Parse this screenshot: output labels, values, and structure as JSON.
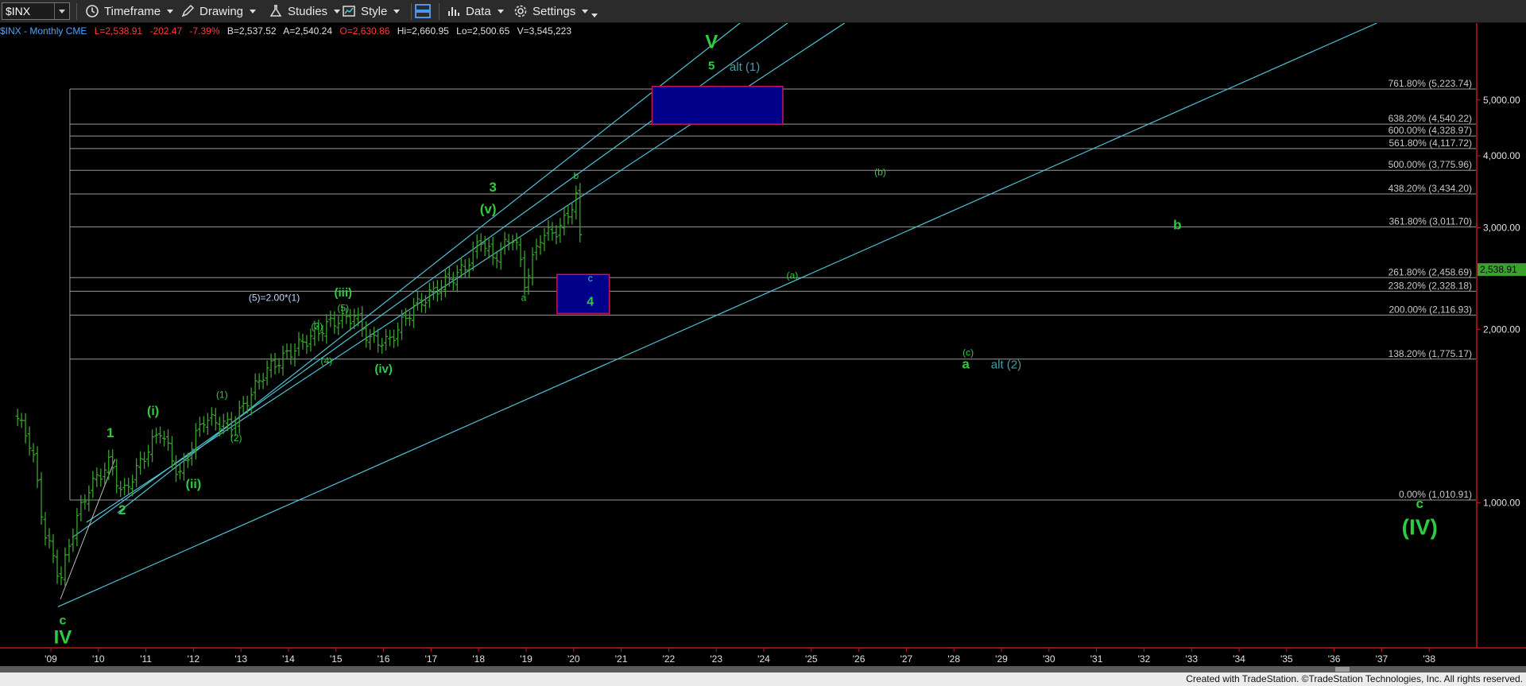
{
  "toolbar": {
    "symbol": "$INX",
    "timeframe": "Timeframe",
    "drawing": "Drawing",
    "studies": "Studies",
    "style": "Style",
    "data": "Data",
    "settings": "Settings"
  },
  "header": {
    "symbol_info": "$INX - Monthly  CME",
    "last": "L=2,538.91",
    "change": "-202.47",
    "change_pct": "-7.39%",
    "bid": "B=2,537.52",
    "ask": "A=2,540.24",
    "open": "O=2,630.86",
    "high": "Hi=2,660.95",
    "low": "Lo=2,500.65",
    "volume": "V=3,545,223"
  },
  "footer_text": "Created with TradeStation. ©TradeStation Technologies, Inc. All rights reserved.",
  "colors": {
    "price_bars": "#3aa12e",
    "channel": "#4fc3d6",
    "fib_lines": "#9a9a9a",
    "label_green": "#2ecc40",
    "label_teal": "#4a9aa8",
    "box_fill": "#00008b",
    "box_border": "#c2185b",
    "last_price_tag": "#3aa12e",
    "down": "#e53935"
  },
  "chart_data": {
    "type": "ohlc",
    "title": "$INX - Monthly",
    "ylim": [
      560,
      6800
    ],
    "log_scale": true,
    "xlim": [
      2008.25,
      2038.9
    ],
    "x_ticks": [
      "'09",
      "'10",
      "'11",
      "'12",
      "'13",
      "'14",
      "'15",
      "'16",
      "'17",
      "'18",
      "'19",
      "'20",
      "'21",
      "'22",
      "'23",
      "'24",
      "'25",
      "'26",
      "'27",
      "'28",
      "'29",
      "'30",
      "'31",
      "'32",
      "'33",
      "'34",
      "'35",
      "'36",
      "'37",
      "'38"
    ],
    "y_ticks": [
      {
        "value": 1000,
        "label": "1,000.00"
      },
      {
        "value": 2000,
        "label": "2,000.00"
      },
      {
        "value": 3000,
        "label": "3,000.00"
      },
      {
        "value": 4000,
        "label": "4,000.00"
      },
      {
        "value": 5000,
        "label": "5,000.00"
      }
    ],
    "last_price": {
      "value": 2538.91,
      "label": "2,538.91"
    },
    "price_series": [
      {
        "year": 2008.3,
        "value": 1400
      },
      {
        "year": 2008.6,
        "value": 1250
      },
      {
        "year": 2008.85,
        "value": 900
      },
      {
        "year": 2009.2,
        "value": 735
      },
      {
        "year": 2009.5,
        "value": 920
      },
      {
        "year": 2009.8,
        "value": 1060
      },
      {
        "year": 2010.25,
        "value": 1180
      },
      {
        "year": 2010.5,
        "value": 1030
      },
      {
        "year": 2010.9,
        "value": 1180
      },
      {
        "year": 2011.3,
        "value": 1340
      },
      {
        "year": 2011.7,
        "value": 1110
      },
      {
        "year": 2012.2,
        "value": 1400
      },
      {
        "year": 2012.8,
        "value": 1360
      },
      {
        "year": 2013.5,
        "value": 1690
      },
      {
        "year": 2014.2,
        "value": 1870
      },
      {
        "year": 2014.9,
        "value": 2060
      },
      {
        "year": 2015.4,
        "value": 2110
      },
      {
        "year": 2015.7,
        "value": 1920
      },
      {
        "year": 2016.1,
        "value": 1900
      },
      {
        "year": 2016.6,
        "value": 2170
      },
      {
        "year": 2017.2,
        "value": 2380
      },
      {
        "year": 2017.7,
        "value": 2550
      },
      {
        "year": 2018.05,
        "value": 2870
      },
      {
        "year": 2018.3,
        "value": 2650
      },
      {
        "year": 2018.75,
        "value": 2920
      },
      {
        "year": 2018.97,
        "value": 2400
      },
      {
        "year": 2019.3,
        "value": 2900
      },
      {
        "year": 2019.7,
        "value": 2980
      },
      {
        "year": 2020.05,
        "value": 3380
      },
      {
        "year": 2020.2,
        "value": 2538.91
      }
    ],
    "fib_levels": [
      {
        "value": 5223.74,
        "label": "761.80% (5,223.74)"
      },
      {
        "value": 4540.22,
        "label": "638.20% (4,540.22)"
      },
      {
        "value": 4328.97,
        "label": "600.00% (4,328.97)"
      },
      {
        "value": 4117.72,
        "label": "561.80% (4,117.72)"
      },
      {
        "value": 3775.96,
        "label": "500.00% (3,775.96)"
      },
      {
        "value": 3434.2,
        "label": "438.20% (3,434.20)"
      },
      {
        "value": 3011.7,
        "label": "361.80% (3,011.70)"
      },
      {
        "value": 2458.69,
        "label": "261.80% (2,458.69)"
      },
      {
        "value": 2328.18,
        "label": "238.20% (2,328.18)"
      },
      {
        "value": 2116.93,
        "label": "200.00% (2,116.93)"
      },
      {
        "value": 1775.17,
        "label": "138.20% (1,775.17)"
      },
      {
        "value": 1010.91,
        "label": "0.00% (1,010.91)"
      }
    ],
    "fib_anchor_year": 2009.4,
    "channels": [
      {
        "x1": 2009.15,
        "y1": 660,
        "x2": 2036.9,
        "y2": 6800
      },
      {
        "x1": 2009.75,
        "y1": 925,
        "x2": 2025.7,
        "y2": 6800
      },
      {
        "x1": 2009.45,
        "y1": 870,
        "x2": 2024.5,
        "y2": 6800
      },
      {
        "x1": 2010.4,
        "y1": 960,
        "x2": 2023.5,
        "y2": 6800
      }
    ],
    "trendline": {
      "x1": 2009.2,
      "y1": 680,
      "x2": 2010.35,
      "y2": 1190
    },
    "boxes": [
      {
        "x1": 2021.65,
        "x2": 2024.4,
        "y1": 4540,
        "y2": 5280
      },
      {
        "x1": 2019.65,
        "x2": 2020.75,
        "y1": 2130,
        "y2": 2490
      }
    ],
    "wave_labels": [
      {
        "text": "V",
        "year": 2022.9,
        "value": 6150,
        "size": 24,
        "bold": true,
        "color": "#2ecc40"
      },
      {
        "text": "5",
        "year": 2022.9,
        "value": 5650,
        "size": 15,
        "bold": true,
        "color": "#2ecc40"
      },
      {
        "text": "alt (1)",
        "year": 2023.6,
        "value": 5620,
        "size": 15,
        "bold": false,
        "color": "#4a9aa8"
      },
      {
        "text": "3",
        "year": 2018.3,
        "value": 3470,
        "size": 17,
        "bold": true,
        "color": "#2ecc40"
      },
      {
        "text": "(v)",
        "year": 2018.2,
        "value": 3180,
        "size": 17,
        "bold": true,
        "color": "#2ecc40"
      },
      {
        "text": "b",
        "year": 2020.05,
        "value": 3650,
        "size": 12,
        "bold": false,
        "color": "#2ecc40"
      },
      {
        "text": "c",
        "year": 2020.35,
        "value": 2420,
        "size": 12,
        "bold": false,
        "color": "#4fc3d6"
      },
      {
        "text": "4",
        "year": 2020.35,
        "value": 2200,
        "size": 16,
        "bold": true,
        "color": "#2ecc40"
      },
      {
        "text": "a",
        "year": 2018.95,
        "value": 2240,
        "size": 12,
        "bold": false,
        "color": "#2ecc40"
      },
      {
        "text": "(5)=2.00*(1)",
        "year": 2013.7,
        "value": 2240,
        "size": 12,
        "bold": false,
        "color": "#c0d8ff"
      },
      {
        "text": "(iii)",
        "year": 2015.15,
        "value": 2280,
        "size": 15,
        "bold": true,
        "color": "#2ecc40"
      },
      {
        "text": "(5)",
        "year": 2015.15,
        "value": 2150,
        "size": 12,
        "bold": false,
        "color": "#2ecc40"
      },
      {
        "text": "(3)",
        "year": 2014.6,
        "value": 2000,
        "size": 12,
        "bold": false,
        "color": "#2ecc40"
      },
      {
        "text": "(4)",
        "year": 2014.8,
        "value": 1740,
        "size": 12,
        "bold": false,
        "color": "#2ecc40"
      },
      {
        "text": "(iv)",
        "year": 2016.0,
        "value": 1680,
        "size": 15,
        "bold": true,
        "color": "#2ecc40"
      },
      {
        "text": "(1)",
        "year": 2012.6,
        "value": 1520,
        "size": 12,
        "bold": false,
        "color": "#2ecc40"
      },
      {
        "text": "(2)",
        "year": 2012.9,
        "value": 1280,
        "size": 12,
        "bold": false,
        "color": "#2ecc40"
      },
      {
        "text": "(i)",
        "year": 2011.15,
        "value": 1420,
        "size": 16,
        "bold": true,
        "color": "#2ecc40"
      },
      {
        "text": "1",
        "year": 2010.25,
        "value": 1300,
        "size": 17,
        "bold": true,
        "color": "#2ecc40"
      },
      {
        "text": "(ii)",
        "year": 2012.0,
        "value": 1060,
        "size": 16,
        "bold": true,
        "color": "#2ecc40"
      },
      {
        "text": "2",
        "year": 2010.5,
        "value": 955,
        "size": 17,
        "bold": true,
        "color": "#2ecc40"
      },
      {
        "text": "c",
        "year": 2009.25,
        "value": 615,
        "size": 16,
        "bold": true,
        "color": "#2ecc40"
      },
      {
        "text": "IV",
        "year": 2009.25,
        "value": 570,
        "size": 24,
        "bold": true,
        "color": "#2ecc40"
      },
      {
        "text": "(b)",
        "year": 2026.45,
        "value": 3700,
        "size": 12,
        "bold": false,
        "color": "#2ecc40"
      },
      {
        "text": "b",
        "year": 2032.7,
        "value": 2980,
        "size": 17,
        "bold": true,
        "color": "#2ecc40"
      },
      {
        "text": "(a)",
        "year": 2024.6,
        "value": 2450,
        "size": 12,
        "bold": false,
        "color": "#2ecc40"
      },
      {
        "text": "(c)",
        "year": 2028.3,
        "value": 1800,
        "size": 12,
        "bold": false,
        "color": "#2ecc40"
      },
      {
        "text": "a",
        "year": 2028.25,
        "value": 1710,
        "size": 17,
        "bold": true,
        "color": "#2ecc40"
      },
      {
        "text": "alt (2)",
        "year": 2029.1,
        "value": 1710,
        "size": 15,
        "bold": false,
        "color": "#4a9aa8"
      },
      {
        "text": "c",
        "year": 2037.8,
        "value": 980,
        "size": 17,
        "bold": true,
        "color": "#2ecc40"
      },
      {
        "text": "(IV)",
        "year": 2037.8,
        "value": 880,
        "size": 28,
        "bold": true,
        "color": "#2ecc40"
      }
    ]
  }
}
